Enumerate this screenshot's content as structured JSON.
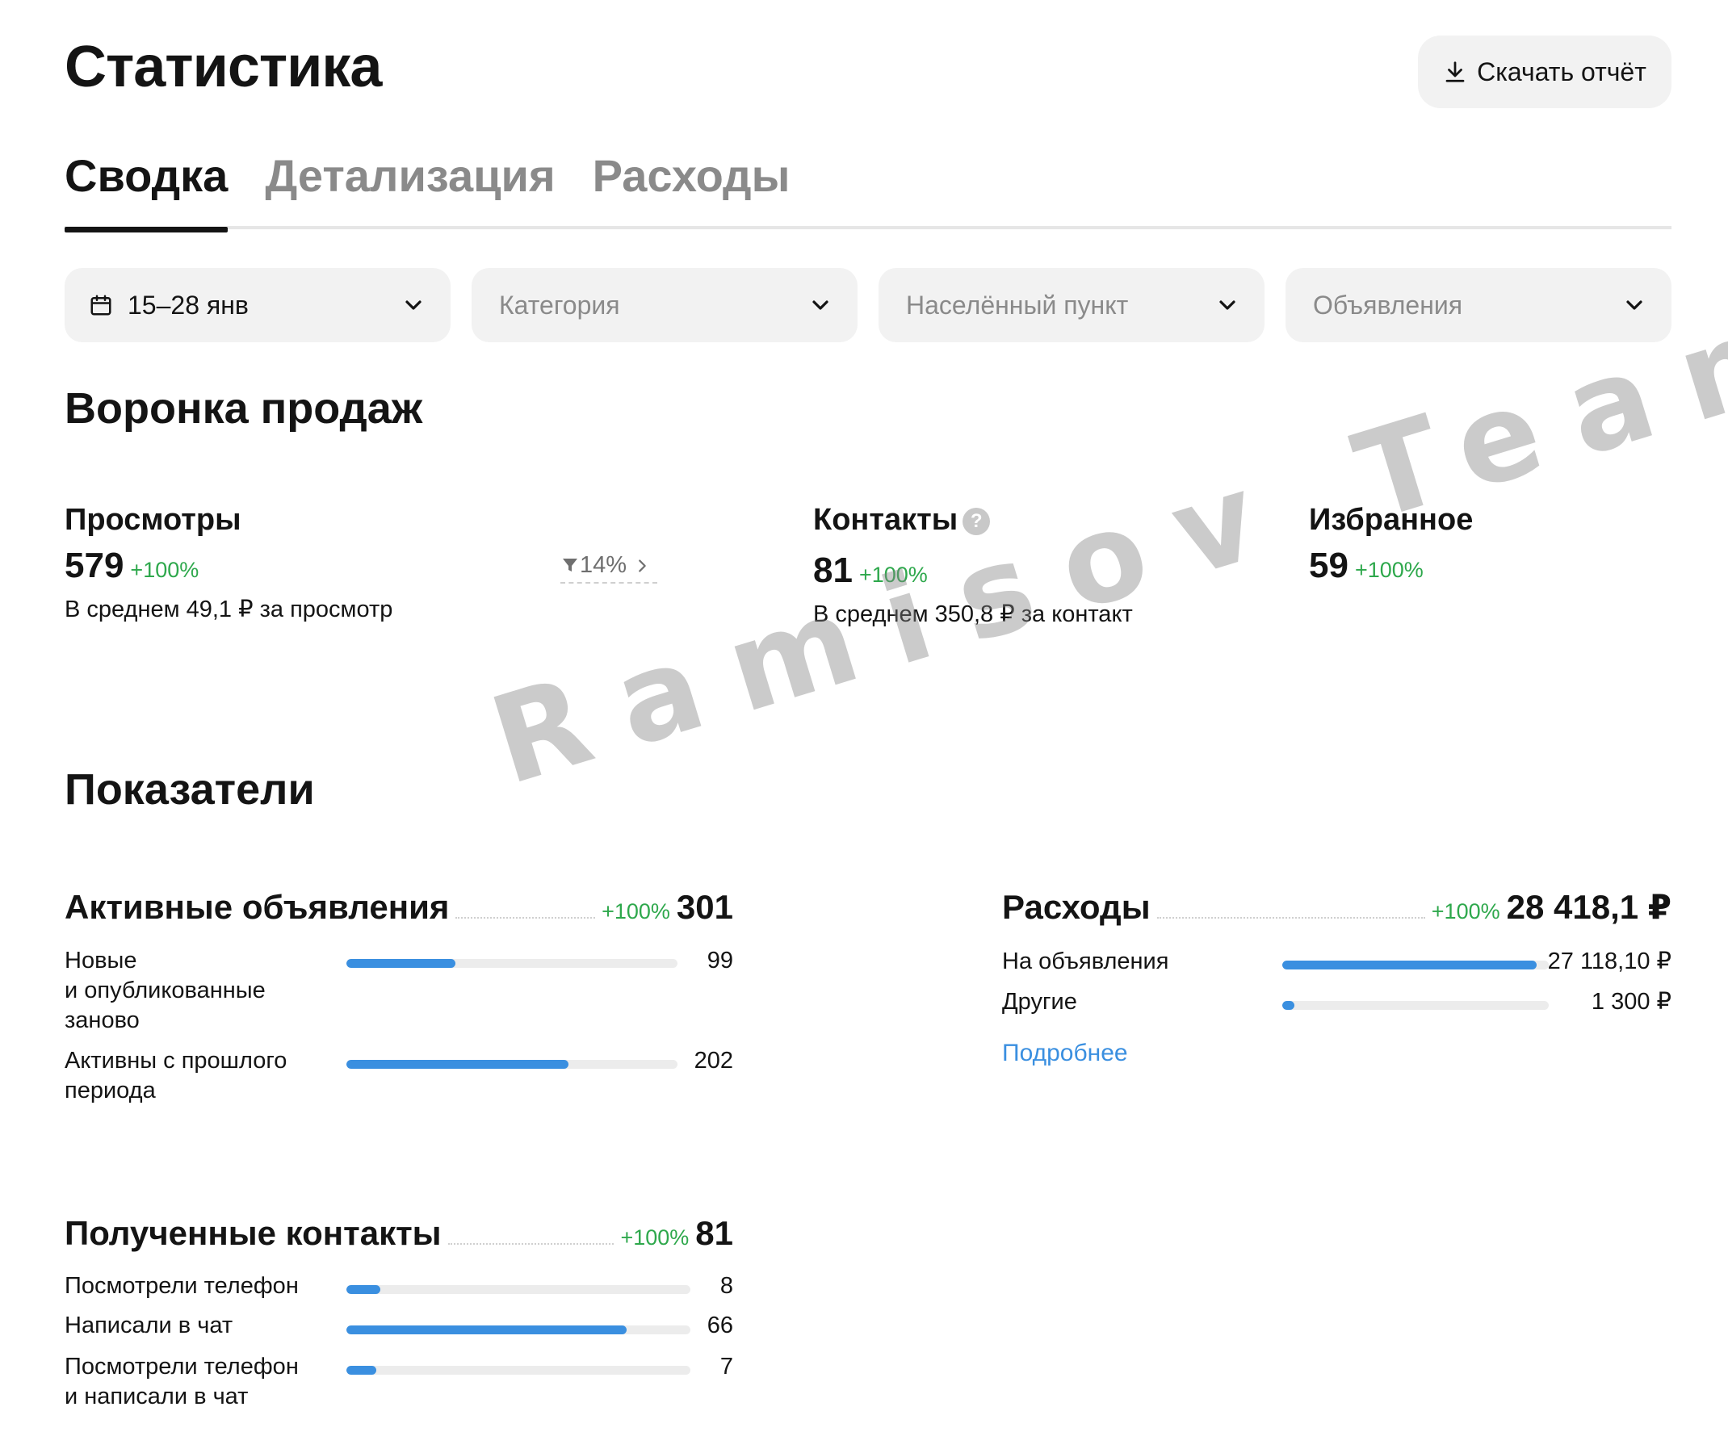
{
  "header": {
    "title": "Статистика",
    "download_label": "Скачать отчёт"
  },
  "tabs": [
    {
      "label": "Сводка",
      "active": true
    },
    {
      "label": "Детализация",
      "active": false
    },
    {
      "label": "Расходы",
      "active": false
    }
  ],
  "filters": {
    "date": "15–28 янв",
    "category": "Категория",
    "city": "Населённый пункт",
    "ads": "Объявления"
  },
  "funnel": {
    "title": "Воронка продаж",
    "views": {
      "title": "Просмотры",
      "value": "579",
      "change": "+100%",
      "sub": "В среднем 49,1 ₽ за просмотр"
    },
    "conversion": "14%",
    "contacts": {
      "title": "Контакты",
      "value": "81",
      "change": "+100%",
      "sub": "В среднем 350,8 ₽ за контакт"
    },
    "favorites": {
      "title": "Избранное",
      "value": "59",
      "change": "+100%"
    }
  },
  "indicators": {
    "title": "Показатели",
    "active_ads": {
      "title": "Активные объявления",
      "change": "+100%",
      "total": "301",
      "rows": [
        {
          "label": "Новые\nи опубликованные\nзаново",
          "value": "99",
          "fraction": 0.33
        },
        {
          "label": "Активны с прошлого\nпериода",
          "value": "202",
          "fraction": 0.67
        }
      ]
    },
    "expenses": {
      "title": "Расходы",
      "change": "+100%",
      "total": "28 418,1 ₽",
      "rows": [
        {
          "label": "На объявления",
          "value": "27 118,10 ₽",
          "fraction": 0.954
        },
        {
          "label": "Другие",
          "value": "1 300 ₽",
          "fraction": 0.046
        }
      ],
      "more_link": "Подробнее"
    },
    "contacts": {
      "title": "Полученные контакты",
      "change": "+100%",
      "total": "81",
      "rows": [
        {
          "label": "Посмотрели телефон",
          "value": "8",
          "fraction": 0.099
        },
        {
          "label": "Написали в чат",
          "value": "66",
          "fraction": 0.815
        },
        {
          "label": "Посмотрели телефон\nи написали в чат",
          "value": "7",
          "fraction": 0.086
        }
      ]
    }
  },
  "watermark": "Ramisov Team",
  "colors": {
    "accent": "#3a8fe0",
    "positive": "#2ea84c",
    "muted": "#8a8a8a",
    "chip_bg": "#f2f2f2"
  },
  "icons": [
    "download-icon",
    "calendar-icon",
    "chevron-down-icon",
    "funnel-icon",
    "chevron-right-icon",
    "help-icon"
  ]
}
